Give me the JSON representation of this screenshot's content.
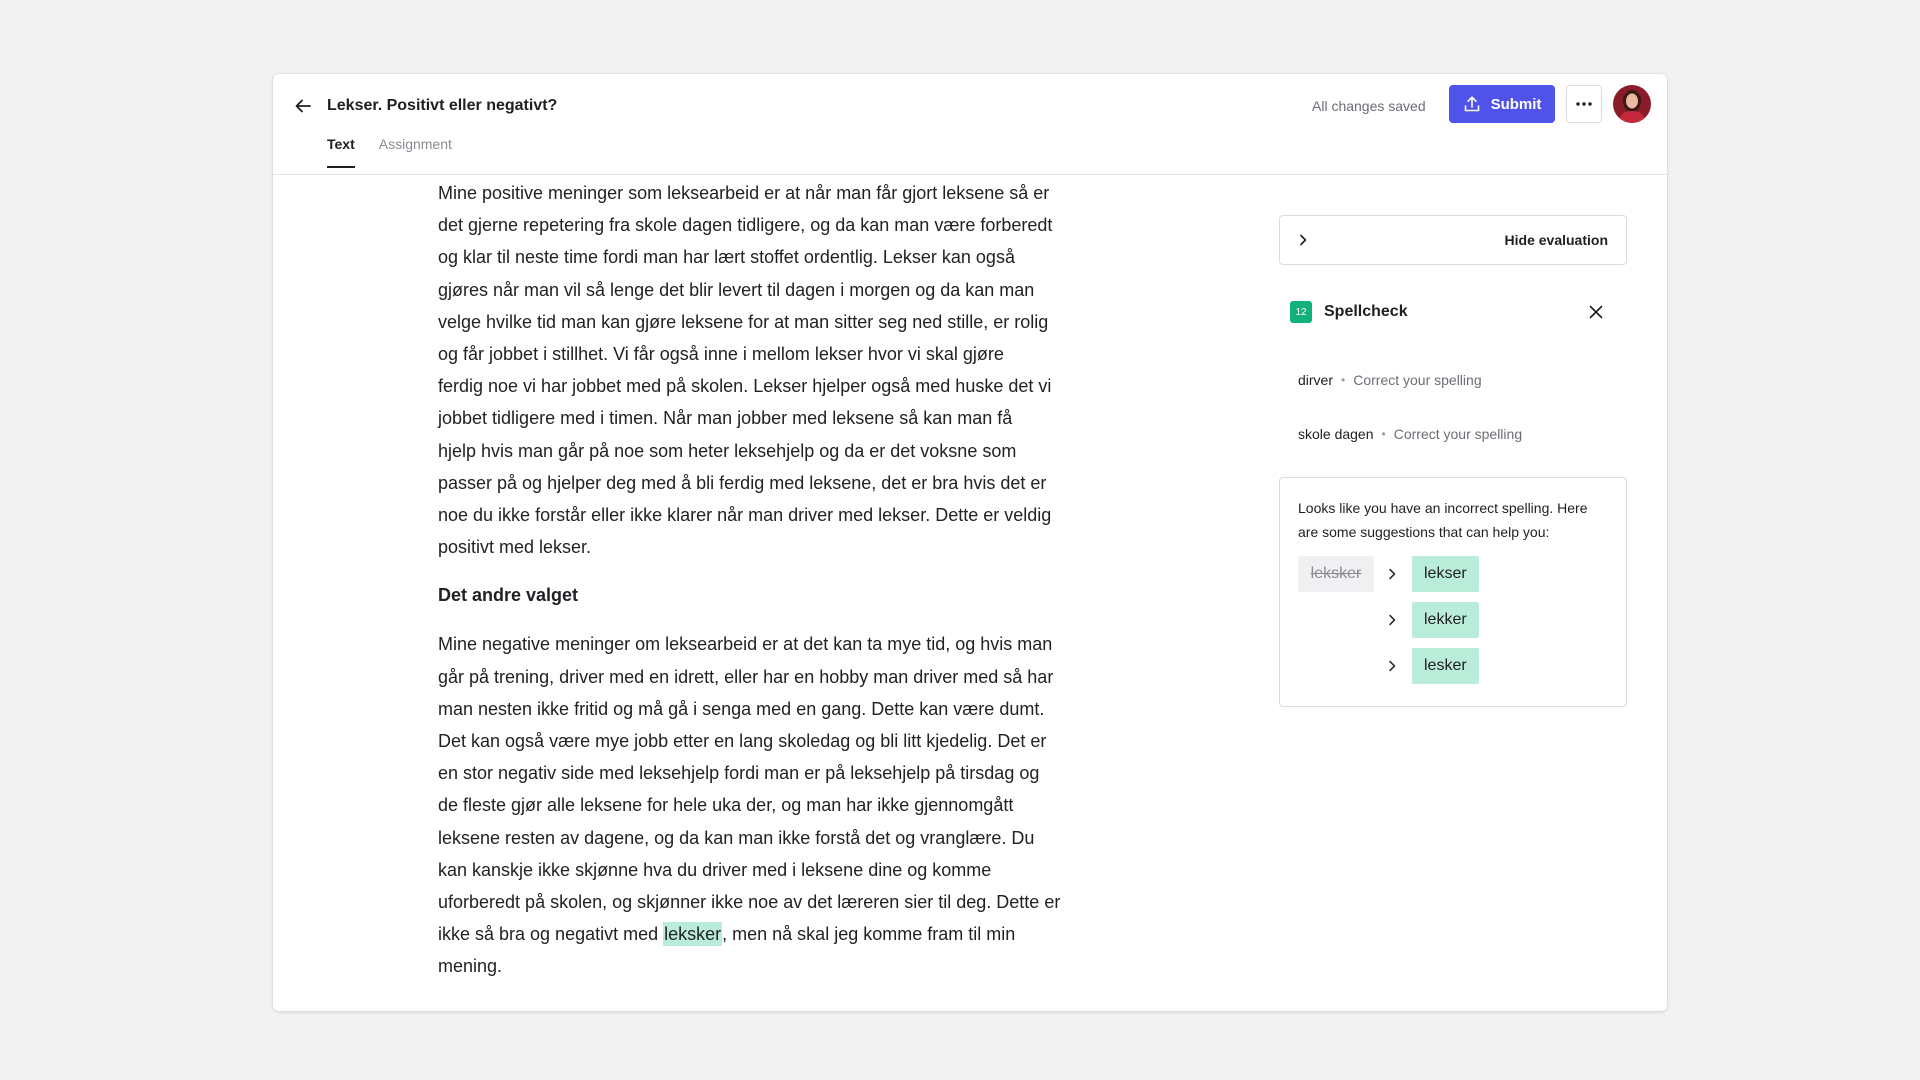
{
  "header": {
    "title": "Lekser. Positivt eller negativt?",
    "tabs": [
      {
        "label": "Text",
        "active": true
      },
      {
        "label": "Assignment",
        "active": false
      }
    ],
    "save_status": "All changes saved",
    "submit_label": "Submit",
    "icons": {
      "back": "arrow-left-icon",
      "submit": "upload-icon",
      "more": "more-horizontal-icon",
      "avatar": "user-avatar"
    }
  },
  "document": {
    "paragraph_1_lines": [
      "Mine positive meninger som leksearbeid er at når man får gjort leksene så er",
      "det gjerne repetering fra skole dagen tidligere, og da kan man være forberedt",
      "og klar til neste time fordi man har lært stoffet ordentlig. Lekser kan også",
      "gjøres når man vil så lenge det blir levert til dagen i morgen og da kan man",
      "velge hvilke tid man kan gjøre leksene for at man sitter seg ned stille, er rolig",
      "og får jobbet i stillhet. Vi får også inne i mellom lekser hvor vi skal gjøre",
      "ferdig noe vi har jobbet med på skolen. Lekser hjelper også med huske det vi",
      "jobbet tidligere med i timen. Når man jobber med leksene så kan man få",
      "hjelp hvis man går på noe som heter leksehjelp og da er det voksne som",
      "passer på og hjelper deg med å bli ferdig med leksene, det er bra hvis det er",
      "noe du ikke forstår eller ikke klarer når man driver med lekser. Dette er veldig",
      "positivt med lekser."
    ],
    "heading": "Det andre valget",
    "paragraph_2_lines": [
      "Mine negative meninger om leksearbeid er at det kan ta mye tid, og hvis man",
      "går på trening, driver med en idrett, eller har en hobby man driver med så har",
      "man nesten ikke fritid og må gå i senga med en gang. Dette kan være dumt.",
      "Det kan også være mye jobb etter en lang skoledag og bli litt kjedelig. Det er",
      "en stor negativ side med leksehjelp fordi man er på leksehjelp på tirsdag og",
      "de fleste gjør alle leksene for hele uka der, og man har ikke gjennomgått",
      "leksene resten av dagene, og da kan man ikke forstå det og vranglære. Du",
      "kan kanskje ikke skjønne hva du driver med i leksene dine og komme",
      "uforberedt på skolen, og skjønner ikke noe av det læreren sier til deg. Dette er"
    ],
    "paragraph_2_last_before": "ikke så bra og negativt med ",
    "paragraph_2_highlight": "leksker",
    "paragraph_2_last_after": ", men nå skal jeg komme fram til min",
    "paragraph_2_final": "mening."
  },
  "panel": {
    "eval_toggle_label": "Hide evaluation",
    "spellcheck": {
      "count": "12",
      "title": "Spellcheck",
      "issues": [
        {
          "word": "dirver",
          "hint": "Correct your spelling"
        },
        {
          "word": "skole dagen",
          "hint": "Correct your spelling"
        }
      ],
      "suggestion_message": "Looks like you have an incorrect spelling. Here are some suggestions that can help you:",
      "original_word": "leksker",
      "suggestions": [
        "lekser",
        "lekker",
        "lesker"
      ]
    }
  },
  "colors": {
    "accent": "#4f53ea",
    "highlight": "#b9ecd9",
    "badge": "#12b17a"
  }
}
